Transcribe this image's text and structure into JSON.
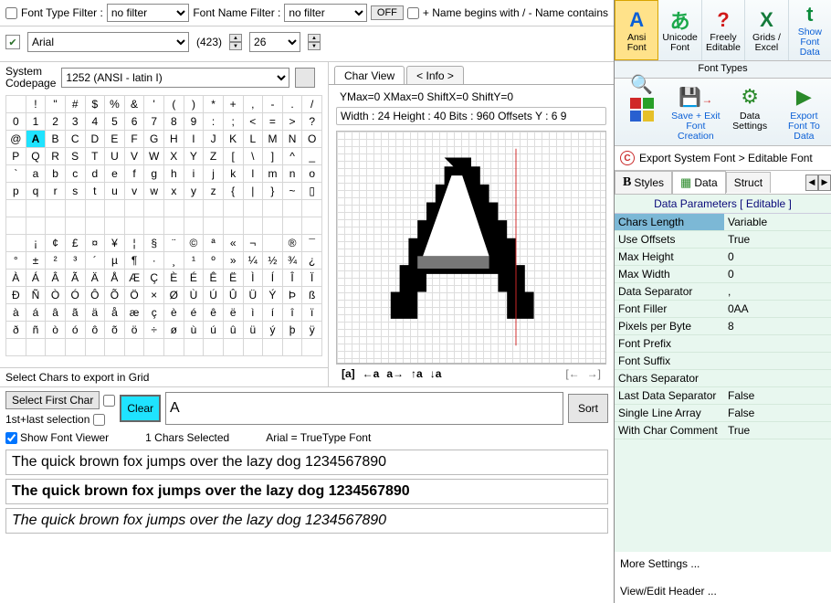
{
  "filters": {
    "font_type_label": "Font Type Filter :",
    "font_type_value": "no filter",
    "font_name_label": "Font Name Filter :",
    "font_name_value": "no filter",
    "off_btn": "OFF",
    "name_begins_label": "+ Name begins with / - Name contains"
  },
  "font_row": {
    "font_name": "Arial",
    "font_count": "(423)",
    "size": "26"
  },
  "codepage": {
    "label": "System\nCodepage",
    "value": "1252  (ANSI - latin I)"
  },
  "char_rows": [
    [
      " ",
      "!",
      "\"",
      "#",
      "$",
      "%",
      "&",
      "'",
      "(",
      ")",
      "*",
      "+",
      ",",
      "-",
      ".",
      "/"
    ],
    [
      "0",
      "1",
      "2",
      "3",
      "4",
      "5",
      "6",
      "7",
      "8",
      "9",
      ":",
      ";",
      "<",
      "=",
      ">",
      "?"
    ],
    [
      "@",
      "A",
      "B",
      "C",
      "D",
      "E",
      "F",
      "G",
      "H",
      "I",
      "J",
      "K",
      "L",
      "M",
      "N",
      "O"
    ],
    [
      "P",
      "Q",
      "R",
      "S",
      "T",
      "U",
      "V",
      "W",
      "X",
      "Y",
      "Z",
      "[",
      "\\",
      "]",
      "^",
      "_"
    ],
    [
      "`",
      "a",
      "b",
      "c",
      "d",
      "e",
      "f",
      "g",
      "h",
      "i",
      "j",
      "k",
      "l",
      "m",
      "n",
      "o"
    ],
    [
      "p",
      "q",
      "r",
      "s",
      "t",
      "u",
      "v",
      "w",
      "x",
      "y",
      "z",
      "{",
      "|",
      "}",
      "~",
      "▯"
    ],
    [
      "",
      "",
      "",
      "",
      "",
      "",
      "",
      "",
      "",
      "",
      "",
      "",
      "",
      "",
      "",
      ""
    ],
    [
      "",
      "",
      "",
      "",
      "",
      "",
      "",
      "",
      "",
      "",
      "",
      "",
      "",
      "",
      "",
      ""
    ],
    [
      " ",
      "¡",
      "¢",
      "£",
      "¤",
      "¥",
      "¦",
      "§",
      "¨",
      "©",
      "ª",
      "«",
      "¬",
      " ",
      "®",
      "¯"
    ],
    [
      "°",
      "±",
      "²",
      "³",
      "´",
      "µ",
      "¶",
      "·",
      "¸",
      "¹",
      "º",
      "»",
      "¼",
      "½",
      "¾",
      "¿"
    ],
    [
      "À",
      "Á",
      "Â",
      "Ã",
      "Ä",
      "Å",
      "Æ",
      "Ç",
      "È",
      "É",
      "Ê",
      "Ë",
      "Ì",
      "Í",
      "Î",
      "Ï"
    ],
    [
      "Ð",
      "Ñ",
      "Ò",
      "Ó",
      "Ô",
      "Õ",
      "Ö",
      "×",
      "Ø",
      "Ù",
      "Ú",
      "Û",
      "Ü",
      "Ý",
      "Þ",
      "ß"
    ],
    [
      "à",
      "á",
      "â",
      "ã",
      "ä",
      "å",
      "æ",
      "ç",
      "è",
      "é",
      "ê",
      "ë",
      "ì",
      "í",
      "î",
      "ï"
    ],
    [
      "ð",
      "ñ",
      "ò",
      "ó",
      "ô",
      "õ",
      "ö",
      "÷",
      "ø",
      "ù",
      "ú",
      "û",
      "ü",
      "ý",
      "þ",
      "ÿ"
    ],
    [
      "",
      "",
      "",
      "",
      "",
      "",
      "",
      "",
      "",
      "",
      "",
      "",
      "",
      "",
      "",
      ""
    ]
  ],
  "selected_cell": {
    "row": 2,
    "col": 1
  },
  "grid_note": "Select Chars to export in Grid",
  "charview": {
    "tab_view": "Char View",
    "tab_info": "< Info >",
    "metrics1": "YMax=0  XMax=0  ShiftX=0  ShiftY=0",
    "metrics2": "Width : 24 Height : 40  Bits : 960  Offsets Y : 6 9"
  },
  "toolbar_glyphs": {
    "brackets": "[a]",
    "left_a": "←a",
    "a_right": "a→",
    "up_a": "↑a",
    "down_a": "↓a",
    "zoom_out": "[←",
    "zoom_in": "→]"
  },
  "lower": {
    "btn_select_first": "Select First Char",
    "label_1st_last": "1st+last selection",
    "btn_clear": "Clear",
    "char_input": "A",
    "btn_sort": "Sort",
    "chk_show_viewer": "Show Font Viewer",
    "chars_selected": "1 Chars Selected",
    "font_type_note": "Arial = TrueType Font",
    "preview_text": "The quick brown fox jumps over the lazy dog 1234567890"
  },
  "ribbon1": {
    "items": [
      {
        "label": "Ansi\nFont",
        "letter": "A",
        "color": "#0a5fd6",
        "active": true
      },
      {
        "label": "Unicode\nFont",
        "letter": "あ",
        "color": "#1ba84a",
        "active": false
      },
      {
        "label": "Freely\nEditable",
        "letter": "?",
        "color": "#d01919",
        "active": false
      },
      {
        "label": "Grids /\nExcel",
        "letter": "X",
        "color": "#137a3a",
        "active": false
      },
      {
        "label": "Show\nFont\nData",
        "letter": "t",
        "color": "#0a8a3a",
        "active": false,
        "text_color": "#0a5fd6"
      }
    ],
    "caption": "Font Types"
  },
  "ribbon2": {
    "items": [
      {
        "id": "search-colors",
        "label": ""
      },
      {
        "id": "save-exit",
        "label": "Save + Exit\nFont\nCreation",
        "color": "#0a5fd6"
      },
      {
        "id": "data-settings",
        "label": "Data\nSettings",
        "color": "#333"
      },
      {
        "id": "export-font",
        "label": "Export\nFont To\nData",
        "color": "#0a5fd6"
      }
    ]
  },
  "export_caption": "Export System Font > Editable Font",
  "prop_tabs": {
    "styles": "Styles",
    "data": "Data",
    "struct": "Struct"
  },
  "params_header": "Data Parameters  [ Editable ]",
  "params": [
    {
      "k": "Chars Length",
      "v": "Variable",
      "sel": true
    },
    {
      "k": "Use Offsets",
      "v": "True"
    },
    {
      "k": "Max Height",
      "v": "0"
    },
    {
      "k": "Max Width",
      "v": "0"
    },
    {
      "k": "Data Separator",
      "v": ","
    },
    {
      "k": "Font Filler",
      "v": "0AA"
    },
    {
      "k": "Pixels per Byte",
      "v": "8"
    },
    {
      "k": "Font Prefix",
      "v": ""
    },
    {
      "k": "Font Suffix",
      "v": ""
    },
    {
      "k": "Chars Separator",
      "v": ""
    },
    {
      "k": "Last Data Separator",
      "v": "False"
    },
    {
      "k": "Single Line Array",
      "v": "False"
    },
    {
      "k": "With Char Comment",
      "v": "True"
    }
  ],
  "params_footer": {
    "more": "More Settings ...",
    "header": "View/Edit Header ..."
  }
}
